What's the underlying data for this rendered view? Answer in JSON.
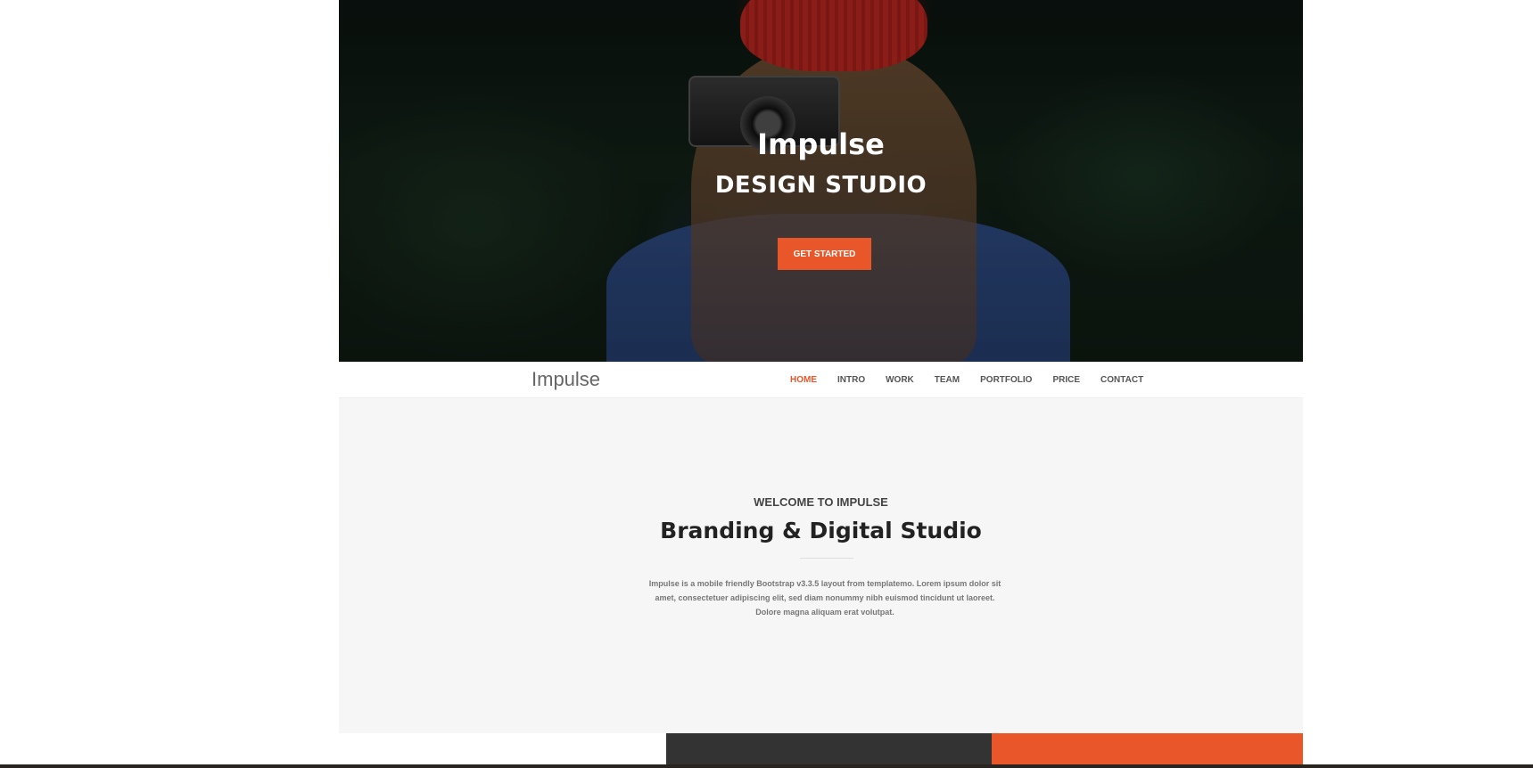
{
  "hero": {
    "title": "Impulse",
    "subtitle": "DESIGN STUDIO",
    "button_label": "GET STARTED"
  },
  "nav": {
    "brand": "Impulse",
    "items": [
      {
        "label": "HOME",
        "active": true
      },
      {
        "label": "INTRO",
        "active": false
      },
      {
        "label": "WORK",
        "active": false
      },
      {
        "label": "TEAM",
        "active": false
      },
      {
        "label": "PORTFOLIO",
        "active": false
      },
      {
        "label": "PRICE",
        "active": false
      },
      {
        "label": "CONTACT",
        "active": false
      }
    ]
  },
  "welcome": {
    "kicker": "WELCOME TO IMPULSE",
    "title": "Branding & Digital Studio",
    "body_lines": [
      "Impulse is a mobile friendly Bootstrap v3.3.5 layout from templatemo. Lorem ipsum dolor sit",
      "amet, consectetuer adipiscing elit, sed diam nonummy nibh euismod tincidunt ut laoreet.",
      "Dolore magna aliquam erat volutpat."
    ]
  },
  "colors": {
    "accent": "#e8562a",
    "dark_panel": "#333333",
    "section_bg": "#f6f6f6"
  }
}
